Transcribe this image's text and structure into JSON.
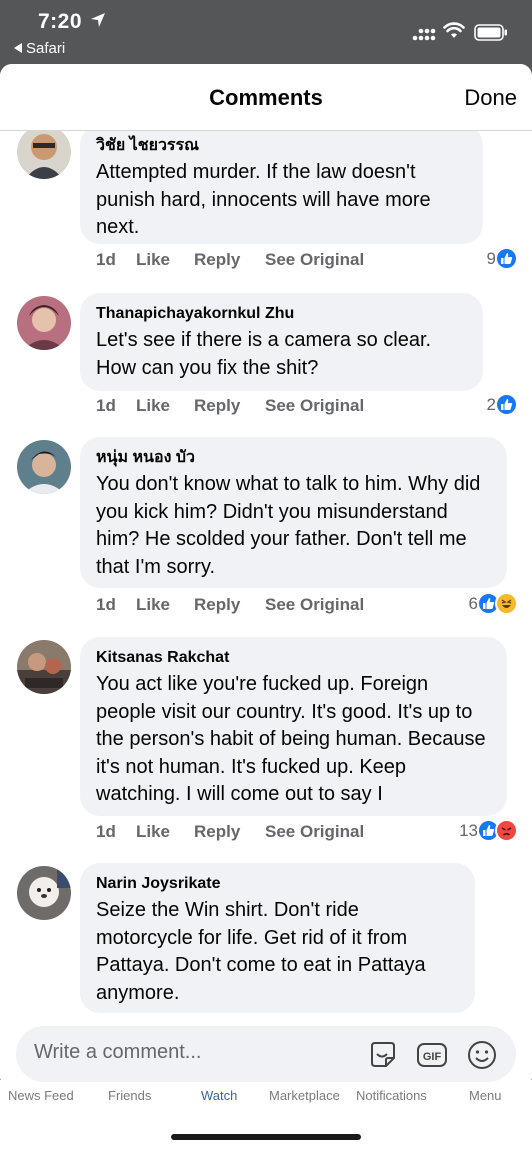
{
  "status_bar": {
    "time": "7:20",
    "back_label": "Safari"
  },
  "sheet": {
    "title": "Comments",
    "done_label": "Done"
  },
  "comments": [
    {
      "author": "วิชัย ไชยวรรณ",
      "text": "Attempted murder. If the law doesn't punish hard, innocents will have more next.",
      "time": "1d",
      "like_label": "Like",
      "reply_label": "Reply",
      "see_original_label": "See Original",
      "reaction_count": "9",
      "reactions": [
        "like"
      ]
    },
    {
      "author": "Thanapichayakornkul Zhu",
      "text": "Let's see if there is a camera so clear. How can you fix the shit?",
      "time": "1d",
      "like_label": "Like",
      "reply_label": "Reply",
      "see_original_label": "See Original",
      "reaction_count": "2",
      "reactions": [
        "like"
      ]
    },
    {
      "author": "หนุ่ม หนอง บัว",
      "text": "You don't know what to talk to him. Why did you kick him? Didn't you misunderstand him? He scolded your father. Don't tell me that I'm sorry.",
      "time": "1d",
      "like_label": "Like",
      "reply_label": "Reply",
      "see_original_label": "See Original",
      "reaction_count": "6",
      "reactions": [
        "like",
        "haha"
      ]
    },
    {
      "author": "Kitsanas Rakchat",
      "text": "You act like you're fucked up. Foreign people visit our country. It's good. It's up to the person's habit of being human. Because it's not human. It's fucked up. Keep watching. I will come out to say I",
      "time": "1d",
      "like_label": "Like",
      "reply_label": "Reply",
      "see_original_label": "See Original",
      "reaction_count": "13",
      "reactions": [
        "like",
        "angry"
      ]
    },
    {
      "author": "Narin Joysrikate",
      "text": "Seize the Win shirt. Don't ride motorcycle for life. Get rid of it from Pattaya. Don't come to eat in Pattaya anymore.",
      "time": "",
      "like_label": "",
      "reply_label": "",
      "see_original_label": "",
      "reaction_count": "",
      "reactions": []
    }
  ],
  "composer": {
    "placeholder": "Write a comment...",
    "icons": [
      "sticker-icon",
      "gif-icon",
      "emoji-icon"
    ]
  },
  "tabbar": {
    "items": [
      "News Feed",
      "Friends",
      "Watch",
      "Marketplace",
      "Notifications",
      "Menu"
    ],
    "active": "Watch"
  },
  "colors": {
    "accent": "#1877f2",
    "bubble": "#f0f2f5",
    "meta_text": "#65676b",
    "backdrop": "#555658"
  }
}
